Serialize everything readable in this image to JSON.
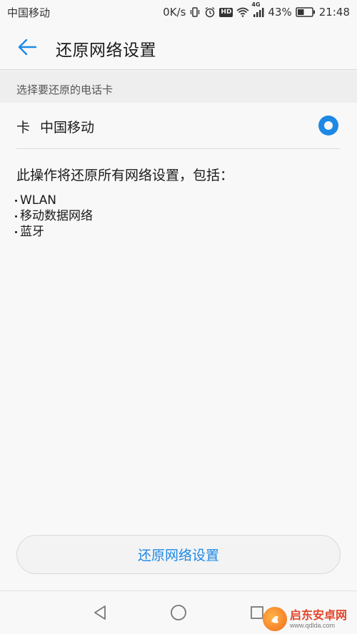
{
  "status_bar": {
    "carrier": "中国移动",
    "net_speed": "0K/s",
    "network_type": "4G",
    "battery": "43%",
    "time": "21:48",
    "icons": [
      "vibrate-icon",
      "alarm-icon",
      "hd-icon",
      "wifi-icon",
      "signal-icon",
      "battery-icon"
    ],
    "hd_label": "HD"
  },
  "header": {
    "title": "还原网络设置",
    "back_icon": "arrow-left-icon",
    "accent_color": "#1e88e5"
  },
  "section": {
    "label": "选择要还原的电话卡"
  },
  "sim_option": {
    "prefix": "卡",
    "carrier": "中国移动",
    "selected": true
  },
  "info": {
    "text": "此操作将还原所有网络设置，包括：",
    "items": [
      "WLAN",
      "移动数据网络",
      "蓝牙"
    ]
  },
  "action": {
    "reset_label": "还原网络设置"
  },
  "nav_bar": {
    "icons": [
      "nav-back-icon",
      "nav-home-icon",
      "nav-recent-icon"
    ]
  },
  "watermark": {
    "name": "启东安卓网",
    "url": "www.qdlda.com"
  }
}
